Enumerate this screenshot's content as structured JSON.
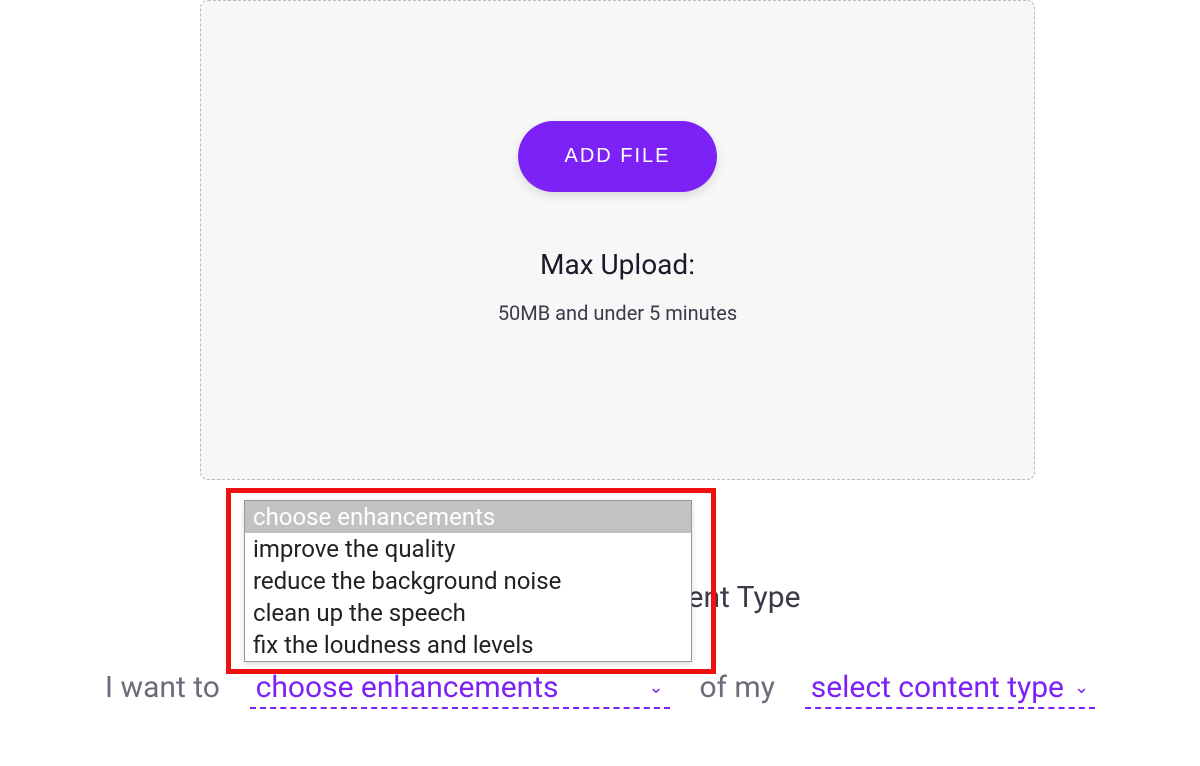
{
  "upload": {
    "button_label": "ADD FILE",
    "heading": "Max Upload:",
    "sub": "50MB and under 5 minutes"
  },
  "section_heading": "Select The Enhancement Type",
  "sentence": {
    "prefix": "I want to",
    "middle": "of my"
  },
  "enhancement_select": {
    "selected": "choose enhancements",
    "options": [
      "choose enhancements",
      "improve the quality",
      "reduce the background noise",
      "clean up the speech",
      "fix the loudness and levels"
    ]
  },
  "content_type_select": {
    "selected": "select content type"
  }
}
